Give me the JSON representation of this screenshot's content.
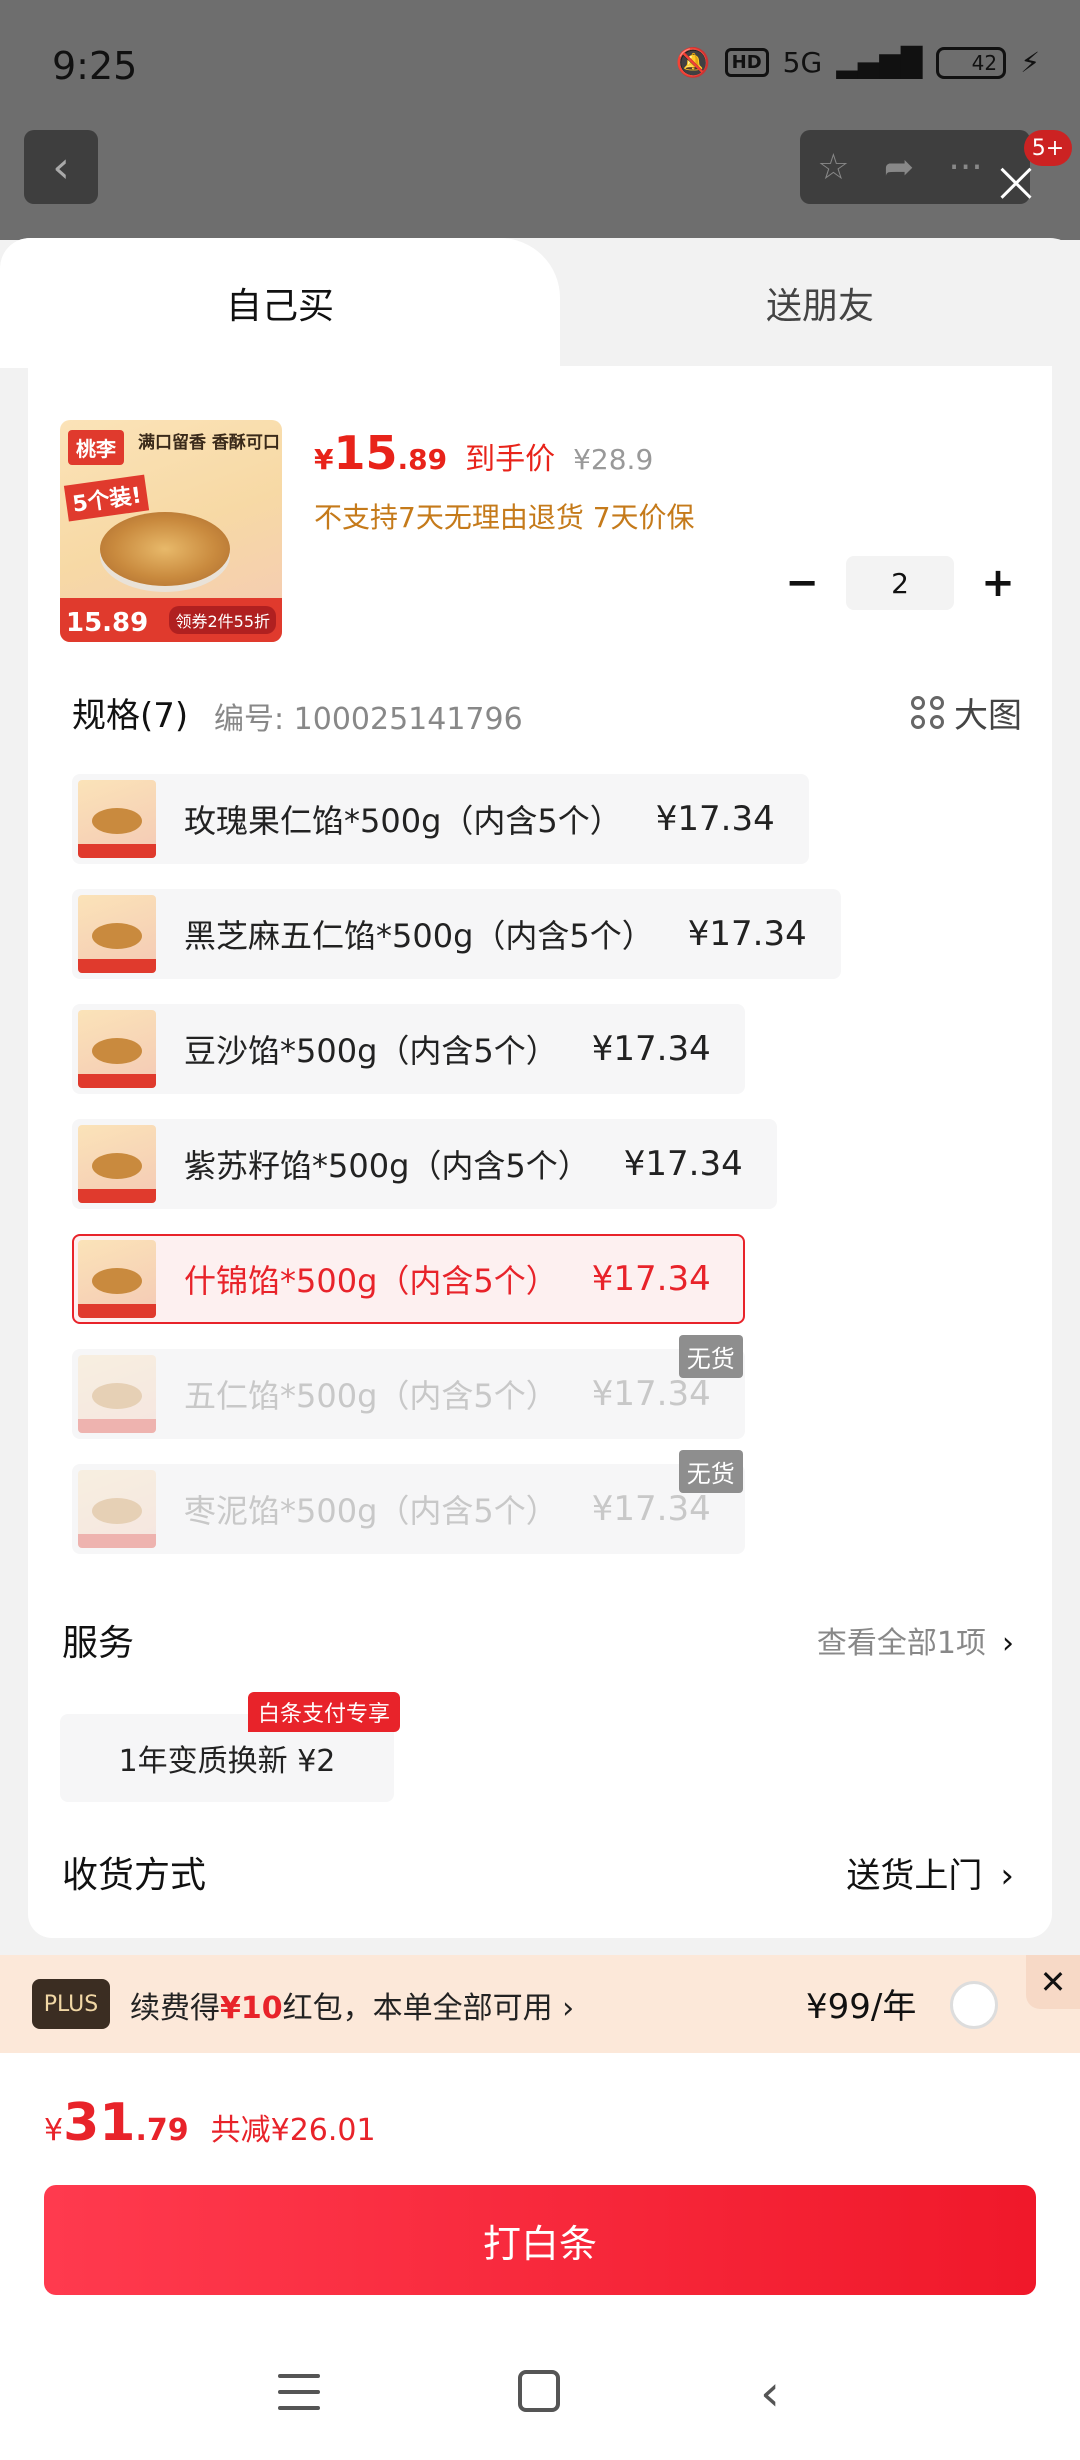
{
  "status_bar": {
    "time": "9:25",
    "network": "5G",
    "hd": "HD",
    "battery": "42"
  },
  "background_page": {
    "back_icon": "chevron-left-icon",
    "badge": "5+"
  },
  "tabs": [
    {
      "label": "自己买",
      "active": true
    },
    {
      "label": "送朋友",
      "active": false
    }
  ],
  "product": {
    "image": {
      "brand": "桃李",
      "slogan": "满口留香 香酥可口",
      "sub": "5个装!",
      "price_label": "15.89",
      "coupon": "领券2件55折"
    },
    "price": {
      "symbol": "¥",
      "integer": "15",
      "decimal": ".89",
      "tag": "到手价",
      "original": "¥28.9"
    },
    "policy": "不支持7天无理由退货  7天价保",
    "quantity": "2",
    "minus": "−",
    "plus": "+"
  },
  "spec": {
    "title": "规格(7)",
    "code": "编号: 100025141796",
    "big_view": "大图",
    "items": [
      {
        "name": "玫瑰果仁馅*500g（内含5个）",
        "price": "¥17.34",
        "state": "normal",
        "stock": ""
      },
      {
        "name": "黑芝麻五仁馅*500g（内含5个）",
        "price": "¥17.34",
        "state": "normal",
        "stock": ""
      },
      {
        "name": "豆沙馅*500g（内含5个）",
        "price": "¥17.34",
        "state": "normal",
        "stock": ""
      },
      {
        "name": "紫苏籽馅*500g（内含5个）",
        "price": "¥17.34",
        "state": "normal",
        "stock": ""
      },
      {
        "name": "什锦馅*500g（内含5个）",
        "price": "¥17.34",
        "state": "selected",
        "stock": ""
      },
      {
        "name": "五仁馅*500g（内含5个）",
        "price": "¥17.34",
        "state": "disabled",
        "stock": "无货"
      },
      {
        "name": "枣泥馅*500g（内含5个）",
        "price": "¥17.34",
        "state": "disabled",
        "stock": "无货"
      }
    ]
  },
  "service": {
    "title": "服务",
    "more": "查看全部1项",
    "chip": "1年变质换新  ¥2",
    "badge": "白条支付专享"
  },
  "delivery": {
    "title": "收货方式",
    "value": "送货上门"
  },
  "plus_bar": {
    "badge": "PLUS",
    "text_prefix": "续费得",
    "text_highlight": "¥10",
    "text_suffix": "红包，本单全部可用 ›",
    "price": "¥99/年",
    "close": "✕"
  },
  "total": {
    "symbol": "¥",
    "integer": "31",
    "decimal": ".79",
    "saved": "共减¥26.01"
  },
  "pay_button": "打白条",
  "colors": {
    "accent": "#e8232a",
    "policy": "#c57a1a",
    "plus_bg": "#fce8d9"
  }
}
